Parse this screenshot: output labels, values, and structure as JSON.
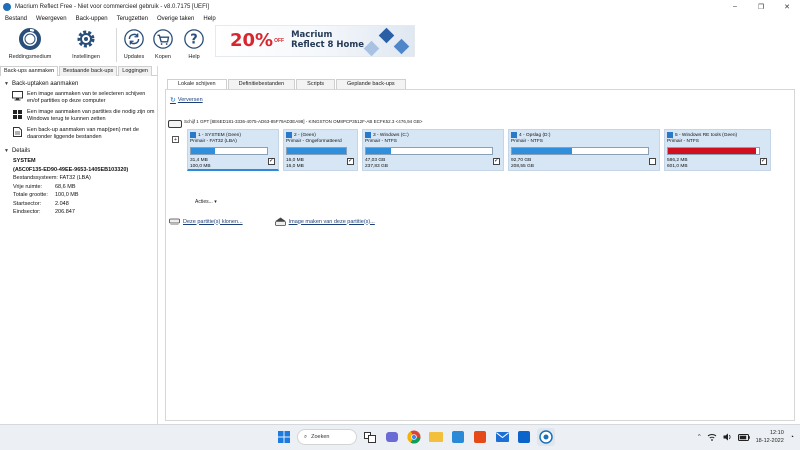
{
  "window": {
    "title": "Macrium Reflect Free - Niet voor commercieel gebruik - v8.0.7175 [UEFI]",
    "controls": [
      "–",
      "❐",
      "✕"
    ]
  },
  "menu": [
    "Bestand",
    "Weergeven",
    "Back-uppen",
    "Terugzetten",
    "Overige taken",
    "Help"
  ],
  "toolbar": {
    "rescue_label": "Reddingsmedium",
    "settings_label": "Instellingen",
    "updates_label": "Updates",
    "buy_label": "Kopen",
    "help_label": "Help",
    "help_glyph": "?"
  },
  "banner": {
    "percent": "20%",
    "off": "OFF",
    "line1": "Macrium",
    "line2": "Reflect 8 Home"
  },
  "left_tabs": [
    "Back-ups aanmaken",
    "Bestaande back-ups",
    "Loggingen"
  ],
  "tasks_header": "Back-uptaken aanmaken",
  "tasks": [
    "Een image aanmaken van te selecteren schijven en/of partities op deze computer",
    "Een image aanmaken van partities die nodig zijn om Windows terug te kunnen zetten",
    "Een back-up aanmaken van map(pen) met de daaronder liggende bestanden"
  ],
  "details": {
    "header": "Details",
    "name": "SYSTEM",
    "guid": "(A5C0F135-ED90-49EE-9653-1405EB103320)",
    "filesystem": "Bestandssysteem: FAT32 (LBA)",
    "free_label": "Vrije ruimte:",
    "free_value": "68,6 MB",
    "total_label": "Totale grootte:",
    "total_value": "100,0 MB",
    "start_label": "Startsector:",
    "start_value": "2.048",
    "end_label": "Eindsector:",
    "end_value": "206.847"
  },
  "right_tabs": [
    "Lokale schijven",
    "Definitiebestanden",
    "Scripts",
    "Geplande back-ups"
  ],
  "refresh_label": "Verversen",
  "disk_header": "Schijf 1 GPT [8E6ED181-3336-4075-AD63-85F79AD3EA98] - KINGSTON OM8PCP3512F-AB ECFK52.3  <476,94 GB>",
  "disk_box_glyph": "+",
  "check_glyph": "✓",
  "partitions": [
    {
      "title": "1 - SYSTEM (Geen)",
      "type": "Primair - FAT32 (LBA)",
      "used": "31,4 MB",
      "total": "100,0 MB",
      "fill": 0.31,
      "color": "#2f8fdd",
      "checked": true
    },
    {
      "title": "2 - (Geen)",
      "type": "Primair - Ongeformatteerd",
      "used": "16,0 MB",
      "total": "16,0 MB",
      "fill": 1.0,
      "color": "#2f8fdd",
      "checked": true
    },
    {
      "title": "3 - Windows (C:)",
      "type": "Primair - NTFS",
      "used": "47,03 GB",
      "total": "237,83 GB",
      "fill": 0.2,
      "color": "#2f8fdd",
      "checked": true
    },
    {
      "title": "4 - Opslag (D:)",
      "type": "Primair - NTFS",
      "used": "92,70 GB",
      "total": "208,55 GB",
      "fill": 0.44,
      "color": "#2f8fdd",
      "checked": false
    },
    {
      "title": "5 - Windows RE tools (Geen)",
      "type": "Primair - NTFS",
      "used": "586,2 MB",
      "total": "601,0 MB",
      "fill": 0.97,
      "color": "#d0101e",
      "checked": true
    }
  ],
  "acties_label": "Acties...",
  "actions": [
    "Deze partitie(s) klonen...",
    "Image maken van deze partitie(s)..."
  ],
  "taskbar": {
    "search_label": "Zoeken",
    "chevron": "^",
    "time": "12:10",
    "date": "18-12-2022"
  }
}
